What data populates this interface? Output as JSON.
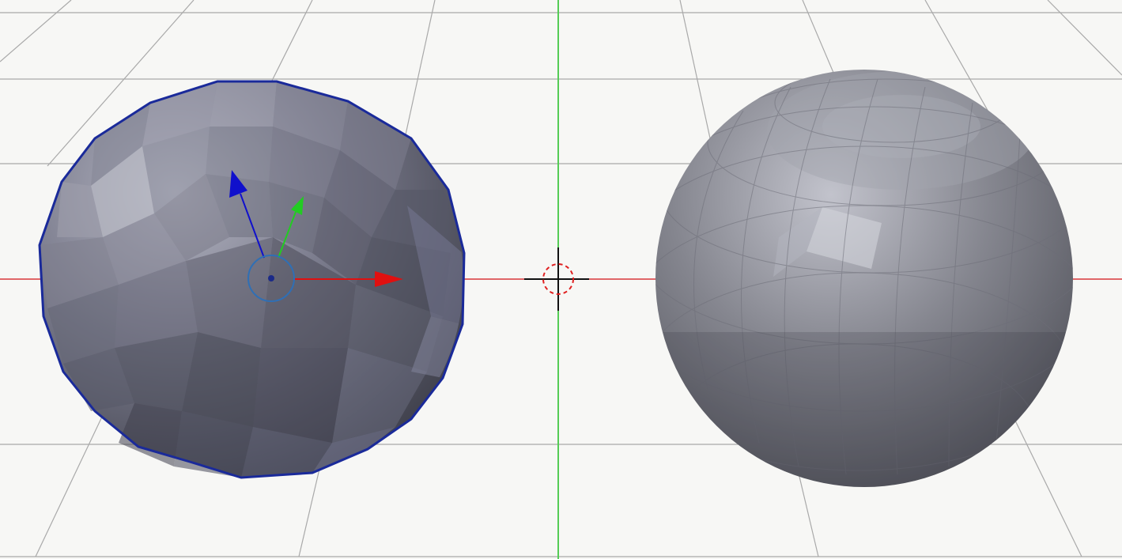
{
  "viewport": {
    "background": "#f7f7f5",
    "grid_color": "#a9a9a9",
    "x_axis_color": "#d9363a",
    "y_axis_color": "#55cc55"
  },
  "objects": [
    {
      "id": "icosphere",
      "selected": true,
      "outline_color": "#1a2a9a"
    },
    {
      "id": "uv-sphere",
      "selected": false
    }
  ],
  "transform_gizmo": {
    "x_color": "#e01010",
    "y_color": "#22cc22",
    "z_color": "#1010cc",
    "origin_ring_color": "#2f6fb5"
  },
  "cursor_3d": {
    "ring_color": "#e02020",
    "cross_color": "#111111"
  }
}
